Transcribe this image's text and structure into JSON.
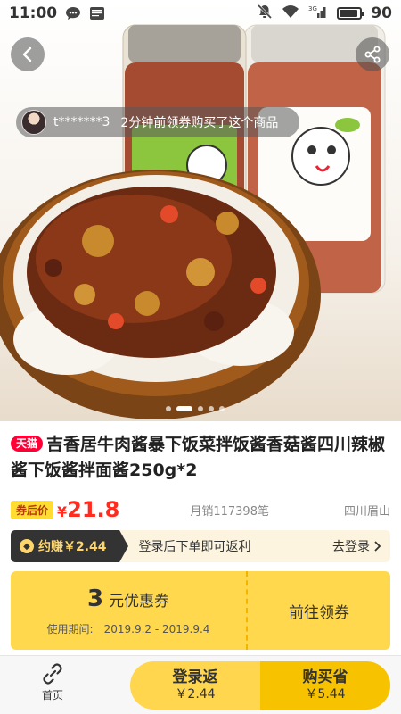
{
  "status_bar": {
    "time": "11:00",
    "battery": "90",
    "battery_fraction": 0.9,
    "network": "3G"
  },
  "hero": {
    "buyer_name": "t*******3",
    "buyer_action": "2分钟前领券购买了这个商品",
    "slide_count": 5,
    "active_slide": 1
  },
  "product": {
    "tmall_badge": "天猫",
    "title": "吉香居牛肉酱暴下饭菜拌饭酱香菇酱四川辣椒酱下饭酱拌面酱250g*2",
    "after_coupon_label": "券后价",
    "currency": "¥",
    "price": "21.8",
    "monthly_sales": "月销117398笔",
    "origin": "四川眉山"
  },
  "rebate": {
    "tag": "约赚￥2.44",
    "hint": "登录后下单即可返利",
    "login_link": "去登录"
  },
  "coupon": {
    "amount": "3",
    "unit": "元优惠券",
    "period_label": "使用期间:",
    "period": "2019.9.2 - 2019.9.4",
    "claim": "前往领券"
  },
  "bottom": {
    "home_label": "首页",
    "login_rebate_label": "登录返",
    "login_rebate_value": "￥2.44",
    "buy_save_label": "购买省",
    "buy_save_value": "￥5.44"
  },
  "colors": {
    "accent_red": "#ff2b1e",
    "coupon_yellow": "#ffd84d",
    "buy_yellow": "#f7c200",
    "tmall_red": "#ff0036"
  }
}
